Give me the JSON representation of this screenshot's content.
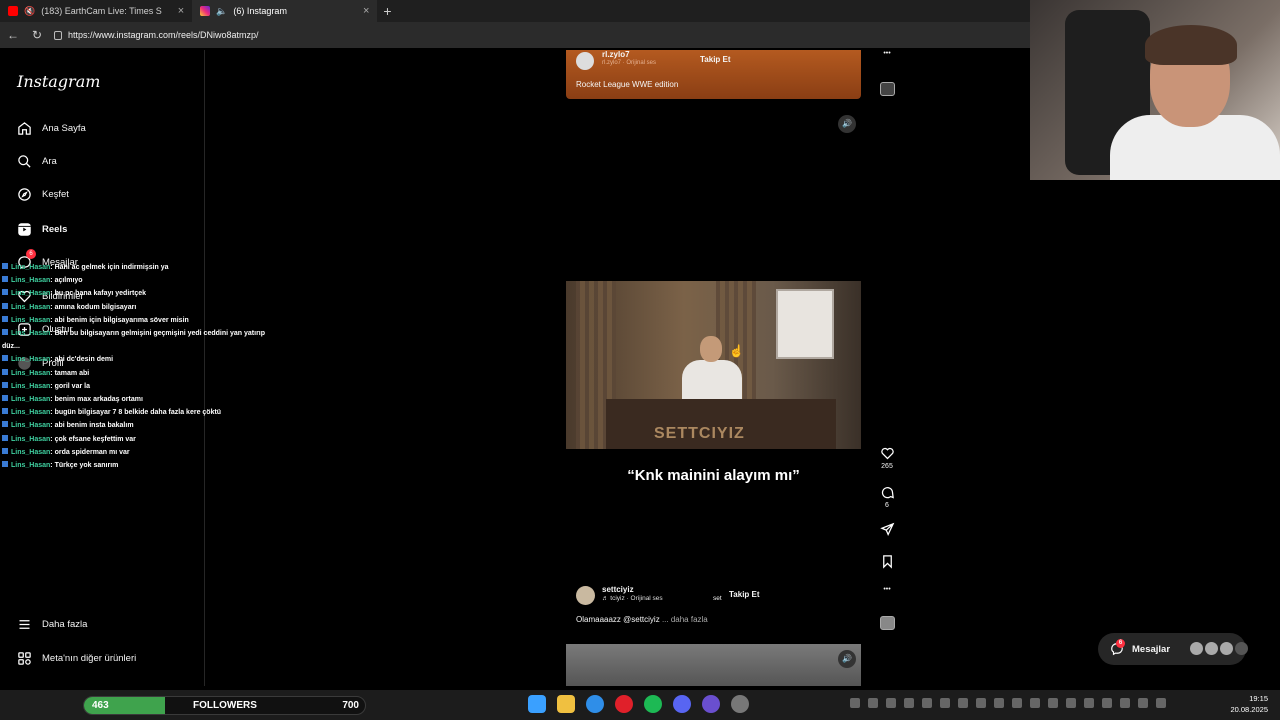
{
  "browser": {
    "tabs": [
      {
        "label": "(183) EarthCam Live: Times S"
      },
      {
        "label": "(6) Instagram"
      }
    ],
    "url": "https://www.instagram.com/reels/DNiwo8atmzp/"
  },
  "sidebar": {
    "logo": "Instagram",
    "items": [
      {
        "label": "Ana Sayfa"
      },
      {
        "label": "Ara"
      },
      {
        "label": "Keşfet"
      },
      {
        "label": "Reels"
      },
      {
        "label": "Mesajlar",
        "badge": "6"
      },
      {
        "label": "Bildirimler"
      },
      {
        "label": "Oluştur"
      },
      {
        "label": "Profil"
      },
      {
        "label": "Daha fazla"
      },
      {
        "label": "Meta'nın diğer ürünleri"
      }
    ]
  },
  "chat": [
    {
      "user": "Lins_Hasan",
      "msg": ": Hani ac gelmek için indirmişsin ya"
    },
    {
      "user": "Lins_Hasan",
      "msg": ": açılmıyo"
    },
    {
      "user": "Lins_Hasan",
      "msg": ": bu pc bana kafayı yedirtçek"
    },
    {
      "user": "Lins_Hasan",
      "msg": ": amına kodum bilgisayarı"
    },
    {
      "user": "Lins_Hasan",
      "msg": ": abi benim için bilgisayarıma söver misin"
    },
    {
      "user": "Lins_Hasan",
      "msg": ": Ben bu bilgisayarın gelmişini geçmişini yedi ceddini yan yatırıp"
    },
    {
      "user": "",
      "msg": "düz..."
    },
    {
      "user": "Lins_Hasan",
      "msg": ": abi dc'desin demi"
    },
    {
      "user": "Lins_Hasan",
      "msg": ": tamam abi"
    },
    {
      "user": "Lins_Hasan",
      "msg": ": goril var la"
    },
    {
      "user": "Lins_Hasan",
      "msg": ": benim max arkadaş ortamı"
    },
    {
      "user": "Lins_Hasan",
      "msg": ": bugün bilgisayar 7 8 belkide daha fazla kere çöktü"
    },
    {
      "user": "Lins_Hasan",
      "msg": ": abi benim insta bakalım"
    },
    {
      "user": "Lins_Hasan",
      "msg": ": çok efsane keşfettim var"
    },
    {
      "user": "Lins_Hasan",
      "msg": ": orda spiderman mı var"
    },
    {
      "user": "Lins_Hasan",
      "msg": ": Türkçe yok sanırım"
    }
  ],
  "reel_prev": {
    "username": "rl.zylo7",
    "audio": "rl.zylo7 · Orijinal ses",
    "follow": "Takip Et",
    "caption": "Rocket League WWE edition"
  },
  "reel": {
    "overlay_text": "“Knk mainini alayım mı”",
    "watermark": "SETTCIYIZ",
    "likes": "265",
    "comments": "6",
    "username": "settciyiz",
    "audio": "♬ tciyiz · Orijinal ses",
    "set_label": "set",
    "follow": "Takip Et",
    "caption_main": "Olamaaaazz @settciyiz",
    "caption_more": "... daha fazla"
  },
  "messages_pill": {
    "label": "Mesajlar",
    "badge": "6"
  },
  "followers": {
    "start": "463",
    "label": "FOLLOWERS",
    "end": "700",
    "fill": 0.29
  },
  "clock": {
    "time": "19:15",
    "date": "20.08.2025"
  }
}
